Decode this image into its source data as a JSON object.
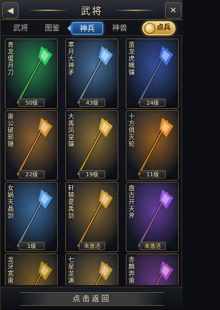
{
  "header": {
    "title": "武将",
    "back_icon": "back-arrow-icon",
    "close_icon": "close-icon"
  },
  "tabs": [
    {
      "label": "武将",
      "active": false
    },
    {
      "label": "图鉴",
      "active": false
    },
    {
      "label": "神兵",
      "active": true
    },
    {
      "label": "神兽",
      "active": false
    }
  ],
  "points_button": {
    "label": "点兵",
    "icon": "coin-icon"
  },
  "weapons": [
    {
      "name": "青龙偃月刀",
      "level": "50级",
      "activated": true,
      "glow": "#2ee06a"
    },
    {
      "name": "寒月大神矛",
      "level": "43级",
      "activated": true,
      "glow": "#6fb8ff"
    },
    {
      "name": "蛮龙虎魄镰",
      "level": "24级",
      "activated": true,
      "glow": "#4a7dff"
    },
    {
      "name": "雷公破邪锤",
      "level": "22级",
      "activated": true,
      "glow": "#f1a233"
    },
    {
      "name": "大禹凤皇镰",
      "level": "19级",
      "activated": true,
      "glow": "#f0b840"
    },
    {
      "name": "十方俱灭轮",
      "level": "11级",
      "activated": true,
      "glow": "#ff9a20"
    },
    {
      "name": "女娲天晶剑",
      "level": "1级",
      "activated": true,
      "glow": "#5ab0ff"
    },
    {
      "name": "轩辕夏禹剑",
      "level": "未激活",
      "activated": false,
      "glow": "#e8a83a"
    },
    {
      "name": "盘古开天斧",
      "level": "未激活",
      "activated": false,
      "glow": "#a55cff"
    },
    {
      "name": "龙牙宽雷",
      "level": "",
      "activated": false,
      "glow": "#c9961f"
    },
    {
      "name": "七星龙渊",
      "level": "",
      "activated": false,
      "glow": "#d4a640"
    },
    {
      "name": "赤麟奔雷",
      "level": "",
      "activated": false,
      "glow": "#b04ccf"
    }
  ],
  "footer": {
    "return_label": "点击返回"
  },
  "colors": {
    "gold": "#f3e4b6",
    "active_tab": "#2c6ab0",
    "frame": "#6a5633"
  }
}
